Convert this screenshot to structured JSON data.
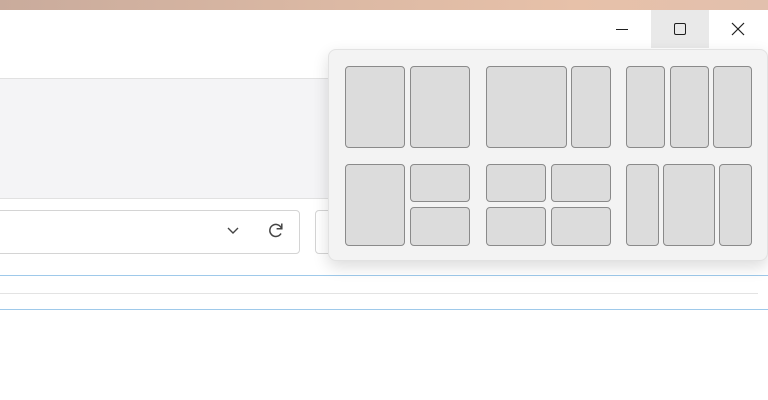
{
  "window": {
    "caption_buttons": [
      {
        "name": "minimize",
        "icon": "minimize-icon"
      },
      {
        "name": "maximize",
        "icon": "maximize-icon",
        "state": "hovered"
      },
      {
        "name": "close",
        "icon": "close-icon"
      }
    ]
  },
  "toolbar": {
    "address_dropdown_icon": "chevron-down-icon",
    "refresh_icon": "refresh-icon"
  },
  "snap_flyout": {
    "layouts": [
      {
        "name": "two-halves",
        "zones": 2
      },
      {
        "name": "two-thirds-one-third",
        "zones": 2
      },
      {
        "name": "three-columns",
        "zones": 3
      },
      {
        "name": "half-and-two-quarters",
        "zones": 3
      },
      {
        "name": "four-quadrants",
        "zones": 4
      },
      {
        "name": "narrow-wide-narrow",
        "zones": 3
      }
    ]
  },
  "colors": {
    "flyout_bg": "#f3f3f3",
    "zone_fill": "#dcdcdc",
    "zone_border": "#8a8a8a",
    "selection_border": "#9ec9ea",
    "wallpaper_accent": "#e7c1a9"
  }
}
